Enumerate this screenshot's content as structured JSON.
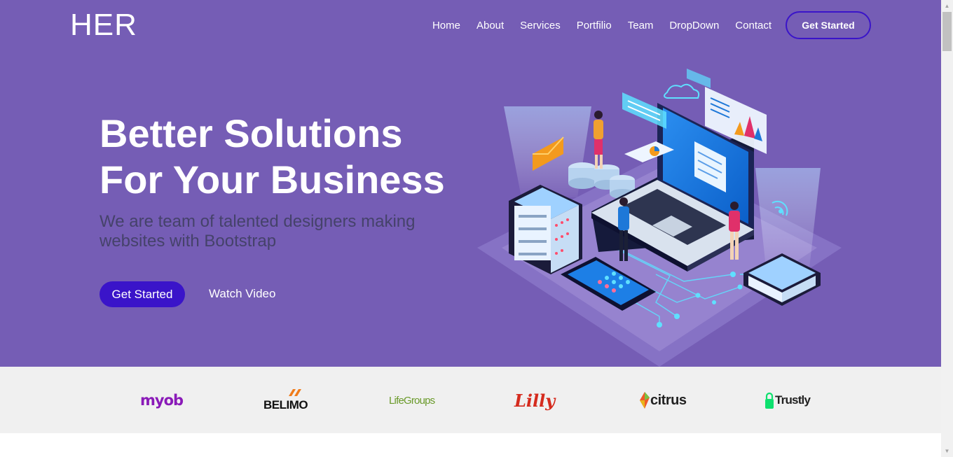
{
  "brand": {
    "name": "HER"
  },
  "nav": {
    "items": [
      {
        "label": "Home"
      },
      {
        "label": "About"
      },
      {
        "label": "Services"
      },
      {
        "label": "Portfilio"
      },
      {
        "label": "Team"
      },
      {
        "label": "DropDown"
      },
      {
        "label": "Contact"
      }
    ],
    "cta_label": "Get Started"
  },
  "hero": {
    "headline_line1": "Better Solutions",
    "headline_line2": "For Your Business",
    "subhead_line1": "We are team of talented designers making",
    "subhead_line2": "websites with Bootstrap",
    "primary_label": "Get Started",
    "video_label": "Watch Video"
  },
  "clients": {
    "logos": [
      {
        "text": "myob",
        "icon": "myob-logo"
      },
      {
        "text": "BELIMO",
        "icon": "belimo-logo"
      },
      {
        "text": "LifeGroups",
        "icon": "lifegroups-logo"
      },
      {
        "text": "Lilly",
        "icon": "lilly-logo"
      },
      {
        "text": "citrus",
        "icon": "citrus-logo"
      },
      {
        "text": "Trustly",
        "icon": "trustly-logo"
      }
    ]
  },
  "colors": {
    "hero_bg": "#755db5",
    "accent": "#3a14c9",
    "logo_strip_bg": "#f0f0f0"
  }
}
